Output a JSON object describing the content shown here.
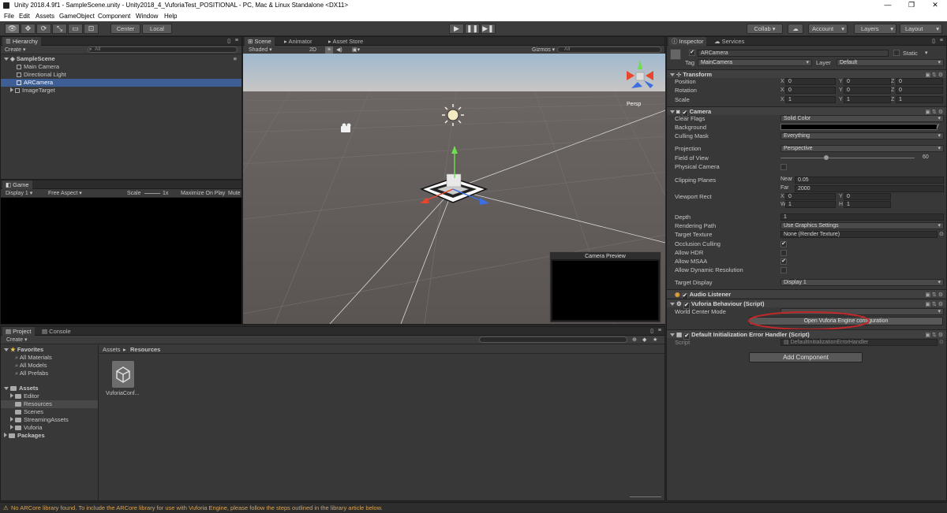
{
  "window": {
    "title": "Unity 2018.4.9f1 - SampleScene.unity - Unity2018_4_VuforiaTest_POSITIONAL - PC, Mac & Linux Standalone <DX11>",
    "controls": {
      "minimize": "—",
      "maximize": "❐",
      "close": "✕"
    }
  },
  "menu": [
    "File",
    "Edit",
    "Assets",
    "GameObject",
    "Component",
    "Window",
    "Help"
  ],
  "toolbar": {
    "pivot_center": "Center",
    "pivot_local": "Local",
    "collab": "Collab ▾",
    "account": "Account",
    "layers": "Layers",
    "layout": "Layout"
  },
  "hierarchy": {
    "tab": "Hierarchy",
    "create": "Create",
    "search_placeholder": "All",
    "scene": "SampleScene",
    "items": [
      "Main Camera",
      "Directional Light",
      "ARCamera",
      "ImageTarget"
    ],
    "selected": "ARCamera"
  },
  "game": {
    "tab": "Game",
    "display": "Display 1",
    "aspect": "Free Aspect",
    "scale_label": "Scale",
    "scale_value": "1x",
    "maximize": "Maximize On Play",
    "mute": "Mute"
  },
  "scene": {
    "tabs": [
      "Scene",
      "Animator",
      "Asset Store"
    ],
    "shading": "Shaded",
    "mode_2d": "2D",
    "gizmos": "Gizmos",
    "search_placeholder": "All",
    "persp": "Persp",
    "camera_preview": "Camera Preview"
  },
  "project": {
    "tabs": [
      "Project",
      "Console"
    ],
    "create": "Create",
    "favorites_label": "Favorites",
    "favorites": [
      "All Materials",
      "All Models",
      "All Prefabs"
    ],
    "assets_label": "Assets",
    "asset_folders": [
      "Editor",
      "Resources",
      "Scenes",
      "StreamingAssets",
      "Vuforia"
    ],
    "packages": "Packages",
    "breadcrumb_root": "Assets",
    "breadcrumb_sep": "▸",
    "breadcrumb_current": "Resources",
    "asset_file": "VuforiaConf..."
  },
  "inspector": {
    "tabs": [
      "Inspector",
      "Services"
    ],
    "object_name": "ARCamera",
    "static": "Static",
    "tag_label": "Tag",
    "tag": "MainCamera",
    "layer_label": "Layer",
    "layer": "Default",
    "transform": {
      "header": "Transform",
      "position_label": "Position",
      "position": [
        "0",
        "0",
        "0"
      ],
      "rotation_label": "Rotation",
      "rotation": [
        "0",
        "0",
        "0"
      ],
      "scale_label": "Scale",
      "scale": [
        "1",
        "1",
        "1"
      ],
      "axes": [
        "X",
        "Y",
        "Z"
      ]
    },
    "camera": {
      "header": "Camera",
      "clear_flags_label": "Clear Flags",
      "clear_flags": "Solid Color",
      "background_label": "Background",
      "culling_mask_label": "Culling Mask",
      "culling_mask": "Everything",
      "projection_label": "Projection",
      "projection": "Perspective",
      "fov_label": "Field of View",
      "fov": "60",
      "physical_label": "Physical Camera",
      "clipping_label": "Clipping Planes",
      "near_label": "Near",
      "near": "0.05",
      "far_label": "Far",
      "far": "2000",
      "viewport_label": "Viewport Rect",
      "vp_x_label": "X",
      "vp_x": "0",
      "vp_y_label": "Y",
      "vp_y": "0",
      "vp_w_label": "W",
      "vp_w": "1",
      "vp_h_label": "H",
      "vp_h": "1",
      "depth_label": "Depth",
      "depth": "1",
      "rendering_label": "Rendering Path",
      "rendering": "Use Graphics Settings",
      "target_texture_label": "Target Texture",
      "target_texture": "None (Render Texture)",
      "occlusion_label": "Occlusion Culling",
      "hdr_label": "Allow HDR",
      "msaa_label": "Allow MSAA",
      "dynres_label": "Allow Dynamic Resolution",
      "target_display_label": "Target Display",
      "target_display": "Display 1"
    },
    "audio_listener": "Audio Listener",
    "vuforia": {
      "header": "Vuforia Behaviour (Script)",
      "world_center_label": "World Center Mode",
      "open_config": "Open Vuforia Engine configuration"
    },
    "default_init": {
      "header": "Default Initialization Error Handler (Script)",
      "script_label": "Script",
      "script": "DefaultInitializationErrorHandler"
    },
    "add_component": "Add Component"
  },
  "status": {
    "message": "No ARCore library found. To include the ARCore library for use with Vuforia Engine, please follow the steps outlined in the library article below."
  },
  "colors": {
    "selection": "#3e5f96",
    "highlight_ellipse": "#c0282a",
    "warning": "#d6a35a"
  }
}
